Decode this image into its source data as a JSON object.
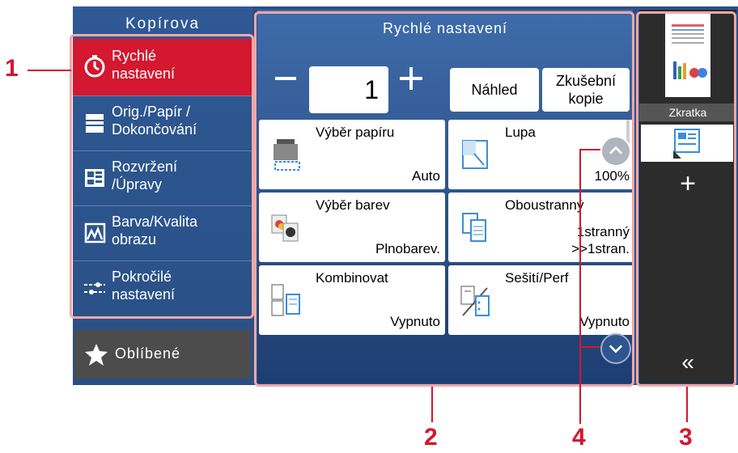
{
  "sidebar": {
    "title": "Kopírova",
    "items": [
      {
        "label_1": "Rychlé",
        "label_2": "nastavení",
        "icon": "stopwatch-icon"
      },
      {
        "label_1": "Orig./Papír /",
        "label_2": "Dokončování",
        "icon": "document-stack-icon"
      },
      {
        "label_1": "Rozvržení",
        "label_2": "/Úpravy",
        "icon": "layout-icon"
      },
      {
        "label_1": "Barva/Kvalita",
        "label_2": "obrazu",
        "icon": "image-quality-icon"
      },
      {
        "label_1": "Pokročilé",
        "label_2": "nastavení",
        "icon": "sliders-icon"
      }
    ],
    "favorites_label": "Oblíbené"
  },
  "main": {
    "title": "Rychlé nastavení",
    "quantity": "1",
    "preview_label": "Náhled",
    "test_copy_label_1": "Zkušební",
    "test_copy_label_2": "kopie",
    "cards": [
      {
        "title": "Výběr papíru",
        "value": "Auto"
      },
      {
        "title": "Lupa",
        "value": "100%"
      },
      {
        "title": "Výběr barev",
        "value": "Plnobarev."
      },
      {
        "title": "Oboustranný",
        "value_1": "1stranný",
        "value_2": ">>1stran."
      },
      {
        "title": "Kombinovat",
        "value": "Vypnuto"
      },
      {
        "title": "Sešití/Perf",
        "value": "Vypnuto"
      }
    ]
  },
  "right_panel": {
    "shortcut_label": "Zkratka",
    "add_symbol": "+",
    "collapse_symbol": "«"
  },
  "callouts": [
    "1",
    "2",
    "3",
    "4"
  ],
  "colors": {
    "accent_red": "#d3182f",
    "screen_blue": "#2b4f86",
    "panel_dark": "#2c2c2c"
  }
}
